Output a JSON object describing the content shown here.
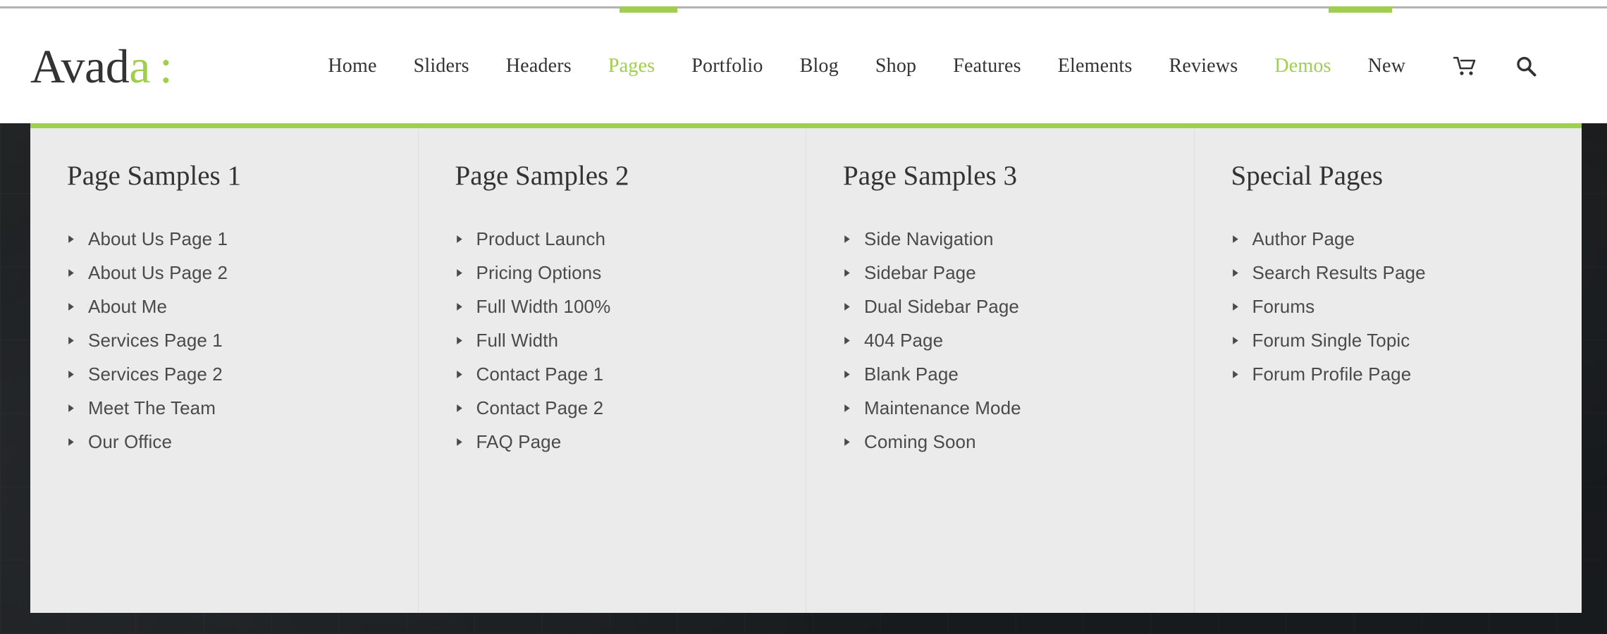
{
  "brand": {
    "name_dark": "Avad",
    "name_accent": "a",
    "colon": ":",
    "accent_color": "#a0ce4e"
  },
  "header": {
    "nav": [
      {
        "label": "Home",
        "active": false
      },
      {
        "label": "Sliders",
        "active": false
      },
      {
        "label": "Headers",
        "active": false
      },
      {
        "label": "Pages",
        "active": true
      },
      {
        "label": "Portfolio",
        "active": false
      },
      {
        "label": "Blog",
        "active": false
      },
      {
        "label": "Shop",
        "active": false
      },
      {
        "label": "Features",
        "active": false
      },
      {
        "label": "Elements",
        "active": false
      },
      {
        "label": "Reviews",
        "active": false
      },
      {
        "label": "Demos",
        "active": true
      },
      {
        "label": "New",
        "active": false
      }
    ],
    "icons": [
      {
        "name": "cart-icon",
        "glyph": "cart"
      },
      {
        "name": "search-icon",
        "glyph": "search"
      }
    ]
  },
  "megamenu": {
    "accent_border_color": "#a0ce4e",
    "background_color": "#ebebeb",
    "columns": [
      {
        "title": "Page Samples 1",
        "items": [
          "About Us Page 1",
          "About Us Page 2",
          "About Me",
          "Services Page 1",
          "Services Page 2",
          "Meet The Team",
          "Our Office"
        ]
      },
      {
        "title": "Page Samples 2",
        "items": [
          "Product Launch",
          "Pricing Options",
          "Full Width 100%",
          "Full Width",
          "Contact Page 1",
          "Contact Page 2",
          "FAQ Page"
        ]
      },
      {
        "title": "Page Samples 3",
        "items": [
          "Side Navigation",
          "Sidebar Page",
          "Dual Sidebar Page",
          "404 Page",
          "Blank Page",
          "Maintenance Mode",
          "Coming Soon"
        ]
      },
      {
        "title": "Special Pages",
        "items": [
          "Author Page",
          "Search Results Page",
          "Forums",
          "Forum Single Topic",
          "Forum Profile Page"
        ]
      }
    ]
  }
}
